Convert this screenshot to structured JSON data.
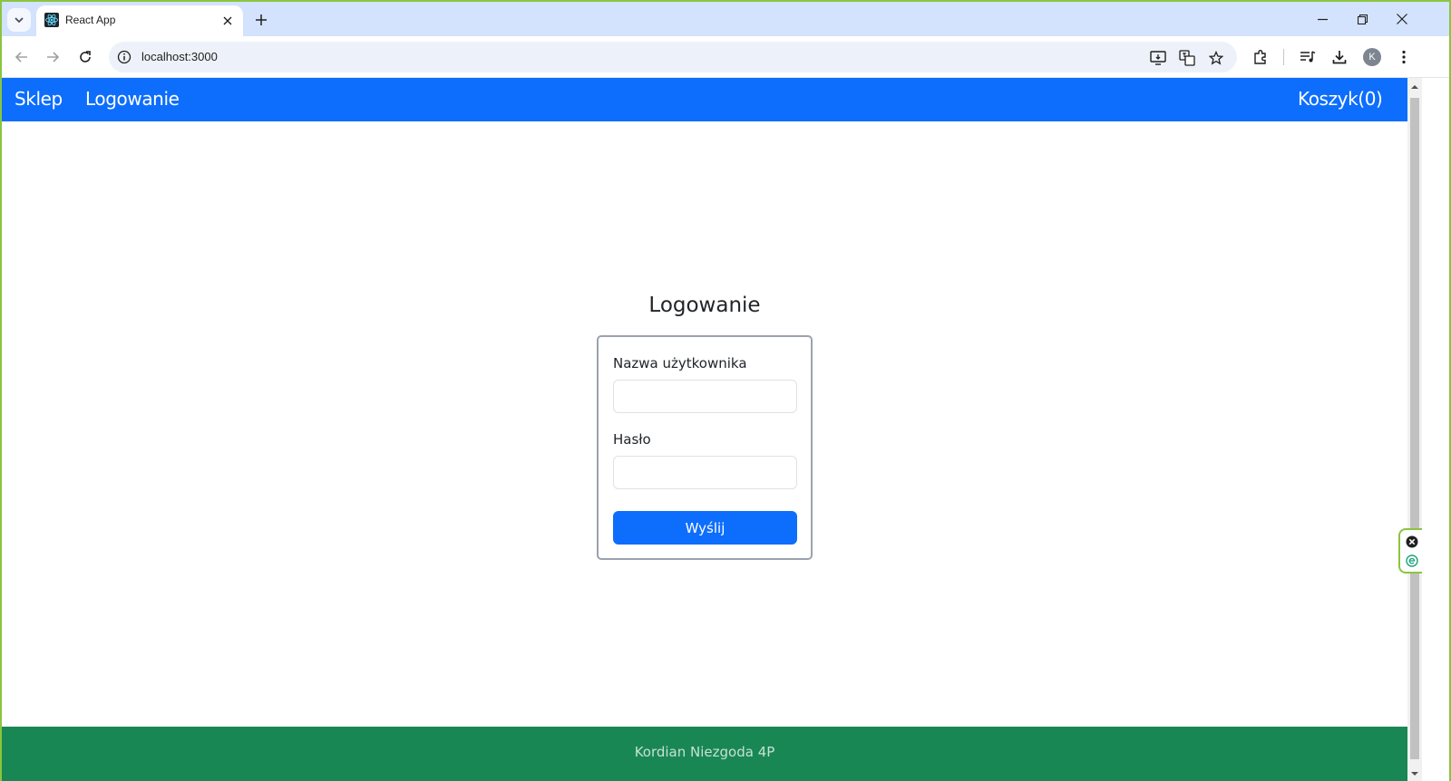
{
  "browser": {
    "tab": {
      "title": "React App",
      "favicon": "react-logo-icon"
    },
    "omnibox": {
      "url": "localhost:3000"
    },
    "profile_initial": "K",
    "icons": [
      "tab-search-icon",
      "close-icon",
      "plus-icon",
      "minimize-icon",
      "restore-icon",
      "window-close-icon",
      "back-arrow-icon",
      "forward-arrow-icon",
      "reload-icon",
      "site-info-icon",
      "install-app-icon",
      "translate-icon",
      "star-icon",
      "extensions-icon",
      "media-control-icon",
      "download-icon",
      "more-menu-icon"
    ]
  },
  "navbar": {
    "brand": "Sklep",
    "login_link": "Logowanie",
    "cart_link": "Koszyk(0)",
    "color": "#0d6efd"
  },
  "login": {
    "heading": "Logowanie",
    "username_label": "Nazwa użytkownika",
    "username_value": "",
    "password_label": "Hasło",
    "password_value": "",
    "submit_label": "Wyślij",
    "button_color": "#0d6efd"
  },
  "footer": {
    "text": "Kordian Niezgoda 4P",
    "color": "#198754"
  }
}
